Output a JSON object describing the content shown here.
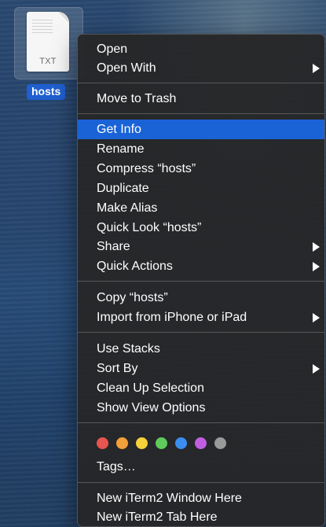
{
  "file": {
    "extension": "TXT",
    "name": "hosts"
  },
  "menu": {
    "group1": [
      {
        "label": "Open",
        "submenu": false
      },
      {
        "label": "Open With",
        "submenu": true
      }
    ],
    "group2": [
      {
        "label": "Move to Trash",
        "submenu": false
      }
    ],
    "group3": [
      {
        "label": "Get Info",
        "submenu": false,
        "highlighted": true
      },
      {
        "label": "Rename",
        "submenu": false
      },
      {
        "label": "Compress “hosts”",
        "submenu": false
      },
      {
        "label": "Duplicate",
        "submenu": false
      },
      {
        "label": "Make Alias",
        "submenu": false
      },
      {
        "label": "Quick Look “hosts”",
        "submenu": false
      },
      {
        "label": "Share",
        "submenu": true
      },
      {
        "label": "Quick Actions",
        "submenu": true
      }
    ],
    "group4": [
      {
        "label": "Copy “hosts”",
        "submenu": false
      },
      {
        "label": "Import from iPhone or iPad",
        "submenu": true
      }
    ],
    "group5": [
      {
        "label": "Use Stacks",
        "submenu": false
      },
      {
        "label": "Sort By",
        "submenu": true
      },
      {
        "label": "Clean Up Selection",
        "submenu": false
      },
      {
        "label": "Show View Options",
        "submenu": false
      }
    ],
    "tags": {
      "colors": [
        {
          "name": "red",
          "hex": "#e8544f"
        },
        {
          "name": "orange",
          "hex": "#f2a03a"
        },
        {
          "name": "yellow",
          "hex": "#f5d23c"
        },
        {
          "name": "green",
          "hex": "#5fcb5a"
        },
        {
          "name": "blue",
          "hex": "#3b8df0"
        },
        {
          "name": "purple",
          "hex": "#bf5fe0"
        },
        {
          "name": "gray",
          "hex": "#9a9a9a"
        }
      ],
      "label": "Tags…"
    },
    "group6": [
      {
        "label": "New iTerm2 Window Here",
        "submenu": false
      },
      {
        "label": "New iTerm2 Tab Here",
        "submenu": false
      }
    ],
    "highlight_color": "#1a63d6"
  }
}
